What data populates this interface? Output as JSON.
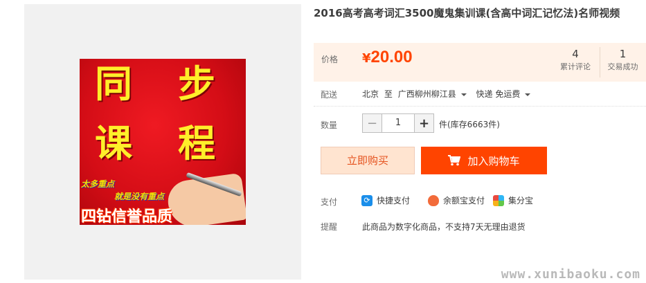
{
  "product": {
    "title": "2016高考高考词汇3500魔鬼集训课(含高中词汇记忆法)名师视频"
  },
  "image": {
    "char1": "同",
    "char2": "步",
    "char3": "课",
    "char4": "程",
    "slogan1": "太多重点",
    "slogan2": "就是没有重点",
    "motto": "四钻信誉品质"
  },
  "price": {
    "label": "价格",
    "currency": "¥",
    "value": "20.00",
    "reviews_count": "4",
    "reviews_label": "累计评论",
    "deals_count": "1",
    "deals_label": "交易成功"
  },
  "shipping": {
    "label": "配送",
    "from": "北京",
    "to_word": "至",
    "destination": "广西柳州柳江县",
    "method": "快递 免运费"
  },
  "quantity": {
    "label": "数量",
    "minus": "−",
    "value": "1",
    "plus": "+",
    "stock_text": "件(库存6663件)"
  },
  "actions": {
    "buy_now": "立即购买",
    "add_to_cart": "加入购物车"
  },
  "payment": {
    "label": "支付",
    "options": [
      "快捷支付",
      "余额宝支付",
      "集分宝"
    ]
  },
  "reminder": {
    "label": "提醒",
    "text": "此商品为数字化商品，不支持7天无理由退货"
  },
  "watermark": "www.xunibaoku.com",
  "colors": {
    "accent": "#ff4400",
    "price_bg": "#fff2e8",
    "buy_now_bg": "#ffe4d0"
  }
}
